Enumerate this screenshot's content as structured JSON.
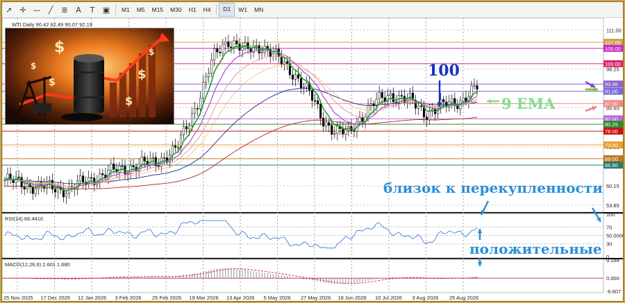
{
  "toolbar": {
    "tools": [
      {
        "icon": "cursor-icon",
        "glyph": "➚"
      },
      {
        "icon": "crosshair-icon",
        "glyph": "✛"
      },
      {
        "icon": "horizontal-line-icon",
        "glyph": "—"
      },
      {
        "icon": "trendline-icon",
        "glyph": "╱"
      },
      {
        "icon": "fibonacci-icon",
        "glyph": "≣"
      },
      {
        "icon": "text-icon",
        "glyph": "A"
      },
      {
        "icon": "label-icon",
        "glyph": "T"
      },
      {
        "icon": "shapes-icon",
        "glyph": "▣"
      }
    ],
    "timeframes": [
      "M1",
      "M5",
      "M15",
      "M30",
      "H1",
      "H4",
      "D1",
      "W1",
      "MN"
    ],
    "active_timeframe": "D1"
  },
  "chart_title": "WTI.Daily  90.42 92.49 90.07 92.19",
  "price_axis": {
    "ticks": [
      "111.00",
      "98.25",
      "85.65",
      "72.80",
      "60.15",
      "53.85"
    ],
    "level_labels": [
      {
        "text": "107.00",
        "value": 107.0,
        "color": "#c9a24a"
      },
      {
        "text": "105.00",
        "value": 105.0,
        "color": "#cc2bcc"
      },
      {
        "text": "100.00",
        "value": 100.0,
        "color": "#e0226e"
      },
      {
        "text": "93.36",
        "value": 93.36,
        "color": "#8f63c9"
      },
      {
        "text": "91.00",
        "value": 91.0,
        "color": "#7a6bd8"
      },
      {
        "text": "87.00",
        "value": 87.0,
        "color": "#f08a8a"
      },
      {
        "text": "82.00",
        "value": 82.0,
        "color": "#b86ad8"
      },
      {
        "text": "80.25",
        "value": 80.25,
        "color": "#2e8b2e"
      },
      {
        "text": "78.00",
        "value": 78.0,
        "color": "#cc1111"
      },
      {
        "text": "73.50",
        "value": 73.5,
        "color": "#e8a030"
      },
      {
        "text": "69.00",
        "value": 69.0,
        "color": "#c07820"
      },
      {
        "text": "66.90",
        "value": 66.9,
        "color": "#2a7a6a"
      }
    ]
  },
  "rsi": {
    "label": "RSI(14) 66.4410",
    "ticks": [
      "100",
      "70",
      "50.0000",
      "30",
      "0"
    ]
  },
  "macd": {
    "label": "MACD(12,26,9) 2.601 1.680",
    "ticks": [
      "9.188",
      "0.000",
      "-6.607"
    ]
  },
  "date_axis": [
    "25 Nov 2025",
    "17 Dec 2025",
    "12 Jan 2026",
    "3 Feb 2026",
    "25 Feb 2026",
    "19 Mar 2026",
    "13 Apr 2026",
    "5 May 2026",
    "27 May 2026",
    "18 Jun 2026",
    "10 Jul 2026",
    "3 Aug 2026",
    "25 Aug 2026"
  ],
  "annotations": {
    "ema_label": "9 EMA",
    "level_100": "100",
    "overbought": "близок к перекупленности",
    "positive": "положительные"
  },
  "colors": {
    "ema_fast": "#1c9e2c",
    "ema_mid": "#b25bd1",
    "ema_slow": "#f0a0a0",
    "sma100": "#1a2a8a",
    "sma200": "#b22222",
    "annotation_blue": "#2b8fd6",
    "annotation_green": "#7ee08a"
  }
}
